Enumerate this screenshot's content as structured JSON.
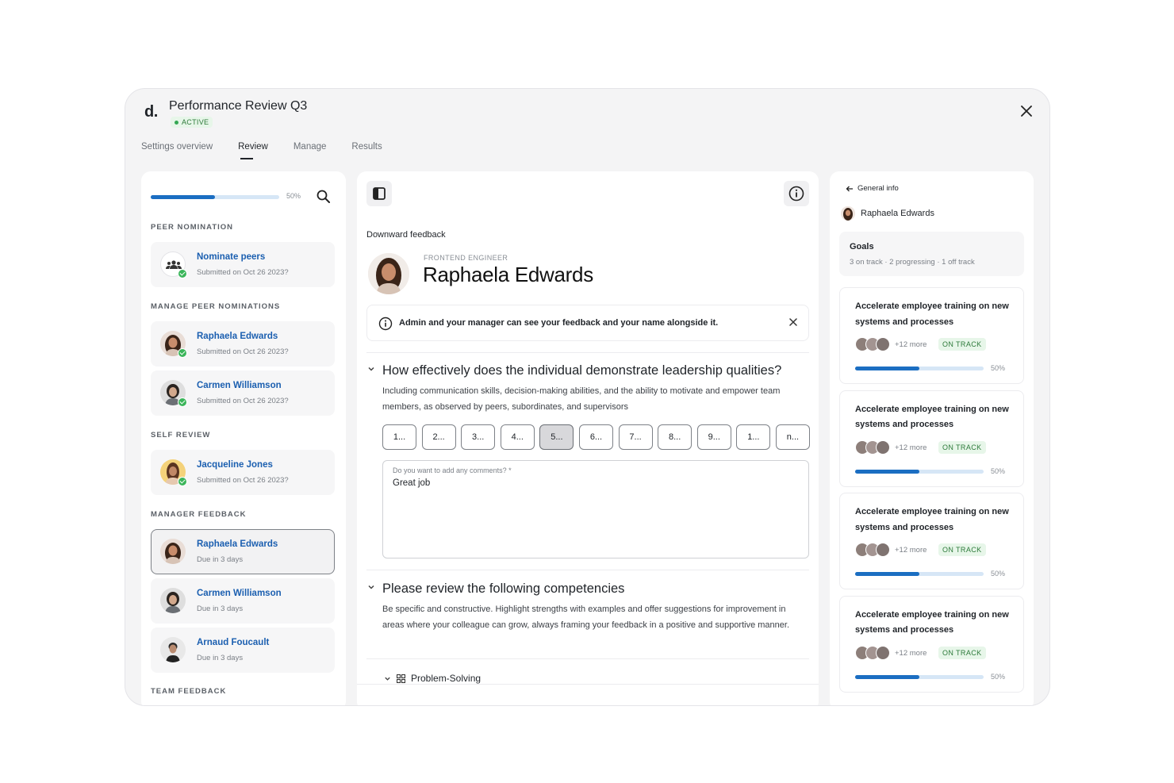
{
  "app": {
    "logo": "d.",
    "title": "Performance Review Q3",
    "status": "ACTIVE"
  },
  "tabs": [
    {
      "label": "Settings overview"
    },
    {
      "label": "Review"
    },
    {
      "label": "Manage"
    },
    {
      "label": "Results"
    }
  ],
  "active_tab": "Review",
  "left": {
    "progress": 0.5,
    "progress_label": "50%",
    "sections": {
      "peer_nomination": "PEER NOMINATION",
      "manage_peer": "MANAGE PEER NOMINATIONS",
      "self_review": "SELF REVIEW",
      "manager_feedback": "MANAGER FEEDBACK",
      "team_feedback": "TEAM FEEDBACK"
    },
    "nominate": {
      "name": "Nominate peers",
      "sub": "Submitted on Oct 26 2023?"
    },
    "peers": [
      {
        "name": "Raphaela Edwards",
        "sub": "Submitted on Oct 26 2023?"
      },
      {
        "name": "Carmen Williamson",
        "sub": "Submitted on Oct 26 2023?"
      }
    ],
    "self": {
      "name": "Jacqueline Jones",
      "sub": "Submitted on Oct 26 2023?"
    },
    "managers": [
      {
        "name": "Raphaela Edwards",
        "sub": "Due in 3 days"
      },
      {
        "name": "Carmen Williamson",
        "sub": "Due in 3 days"
      },
      {
        "name": "Arnaud Foucault",
        "sub": "Due in 3 days"
      }
    ]
  },
  "center": {
    "caption": "Downward feedback",
    "role": "FRONTEND ENGINEER",
    "name": "Raphaela Edwards",
    "notice": "Admin and your manager can see your feedback and your name alongside it.",
    "q1": {
      "title": "How effectively does the individual demonstrate leadership qualities?",
      "desc": "Including communication skills, decision-making abilities, and the ability to motivate and empower team members, as observed by peers, subordinates, and supervisors",
      "scale": [
        "1...",
        "2...",
        "3...",
        "4...",
        "5...",
        "6...",
        "7...",
        "8...",
        "9...",
        "1...",
        "n..."
      ],
      "selected": 4,
      "comment_label": "Do you want to add any comments? *",
      "comment_value": "Great job"
    },
    "q2": {
      "title": "Please review the following competencies",
      "desc": "Be specific and constructive. Highlight strengths with examples and offer suggestions for improvement in areas where your colleague can grow, always framing your feedback in a positive and supportive manner."
    },
    "sub_item": "Problem-Solving"
  },
  "right": {
    "back": "General info",
    "person": "Raphaela Edwards",
    "goals_title": "Goals",
    "goals_summary": "3 on track · 2 progressing · 1 off track",
    "goals": [
      {
        "title": "Accelerate employee training on new systems and processes",
        "more": "+12 more",
        "status": "ON TRACK",
        "progress": 0.5,
        "pct": "50%"
      },
      {
        "title": "Accelerate employee training on new systems and processes",
        "more": "+12 more",
        "status": "ON TRACK",
        "progress": 0.5,
        "pct": "50%"
      },
      {
        "title": "Accelerate employee training on new systems and processes",
        "more": "+12 more",
        "status": "ON TRACK",
        "progress": 0.5,
        "pct": "50%"
      },
      {
        "title": "Accelerate employee training on new systems and processes",
        "more": "+12 more",
        "status": "ON TRACK",
        "progress": 0.5,
        "pct": "50%"
      }
    ]
  }
}
